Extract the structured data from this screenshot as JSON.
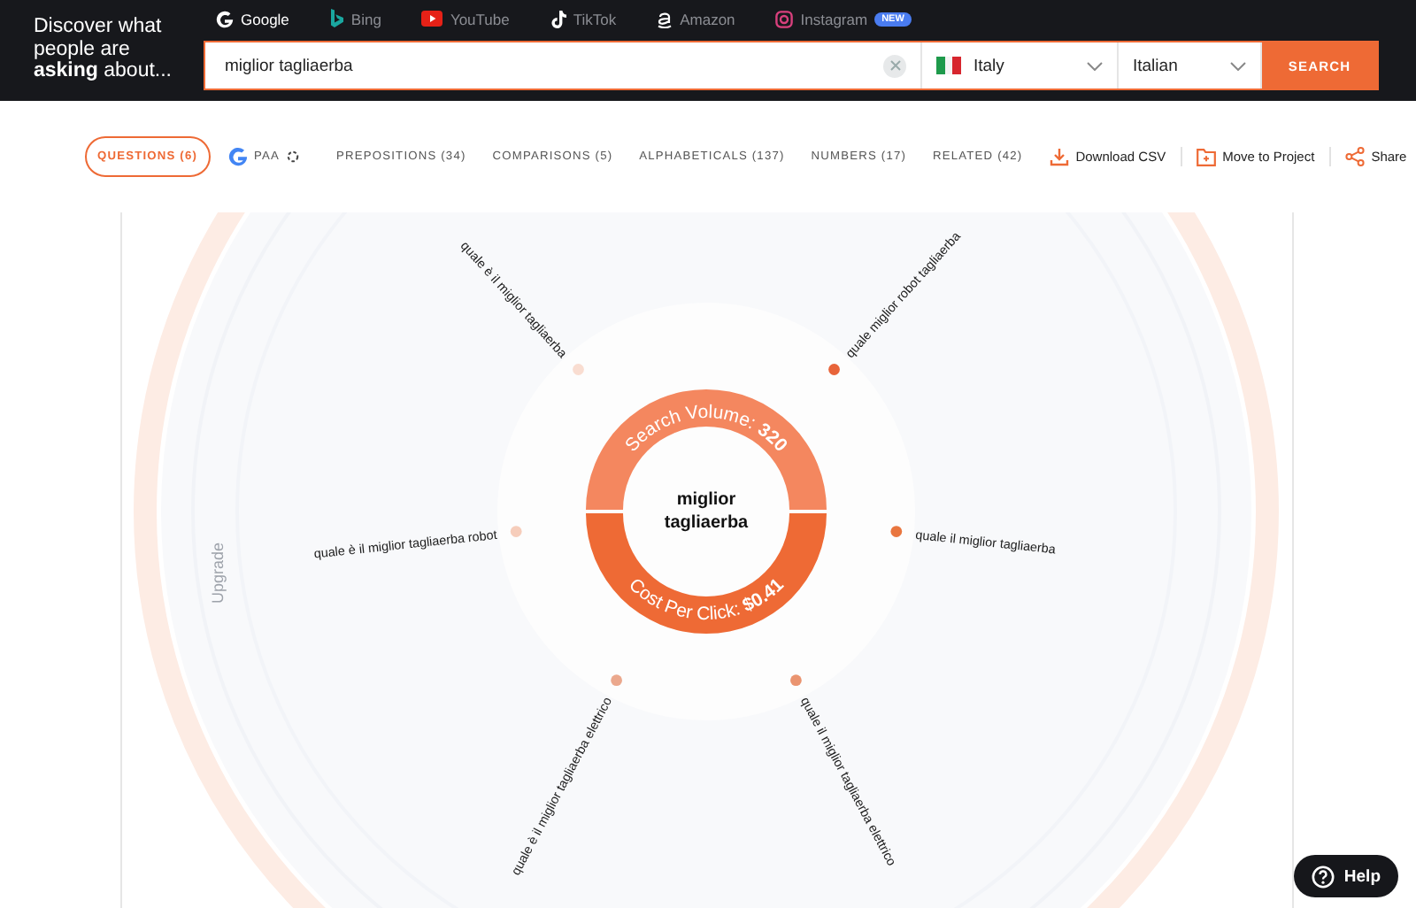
{
  "header": {
    "tagline": "Discover what people are **asking** about...",
    "engines": [
      {
        "label": "Google",
        "kind": "google",
        "selected": true
      },
      {
        "label": "Bing",
        "kind": "bing",
        "selected": false
      },
      {
        "label": "YouTube",
        "kind": "youtube",
        "selected": false
      },
      {
        "label": "TikTok",
        "kind": "tiktok",
        "selected": false
      },
      {
        "label": "Amazon",
        "kind": "amazon",
        "selected": false
      },
      {
        "label": "Instagram",
        "kind": "instagram",
        "selected": false,
        "badge": "NEW"
      }
    ]
  },
  "search": {
    "value": "miglior tagliaerba"
  },
  "country": {
    "value": "Italy"
  },
  "language": {
    "value": "Italian"
  },
  "search_button": "SEARCH",
  "filters": [
    {
      "label": "QUESTIONS (6)",
      "kind": "pill",
      "selected": true
    },
    {
      "label": "PAA",
      "kind": "paa",
      "selected": false
    },
    {
      "label": "PREPOSITIONS (34)",
      "kind": "plain",
      "selected": false
    },
    {
      "label": "COMPARISONS (5)",
      "kind": "plain",
      "selected": false
    },
    {
      "label": "ALPHABETICALS (137)",
      "kind": "plain",
      "selected": false
    },
    {
      "label": "NUMBERS (17)",
      "kind": "plain",
      "selected": false
    },
    {
      "label": "RELATED (42)",
      "kind": "plain",
      "selected": false
    }
  ],
  "actions": [
    {
      "label": "Download CSV",
      "kind": "download"
    },
    {
      "label": "Move to Project",
      "kind": "folder"
    },
    {
      "label": "Share",
      "kind": "share"
    }
  ],
  "visualization": {
    "keyword": "miglior tagliaerba",
    "search_volume": {
      "label": "Search Volume:",
      "value": "320"
    },
    "cost_per_click": {
      "label": "Cost Per Click:",
      "value": "$0.41"
    },
    "upgrade": "Upgrade",
    "questions": [
      {
        "text": "quale è il miglior tagliaerba",
        "color": "#f9ddd1"
      },
      {
        "text": "quale miglior robot tagliaerba",
        "color": "#e8643a"
      },
      {
        "text": "quale è il miglior tagliaerba robot",
        "color": "#f6cdbb"
      },
      {
        "text": "quale il miglior tagliaerba",
        "color": "#e9763f"
      },
      {
        "text": "quale è il miglior tagliaerba elettrico",
        "color": "#eba88d"
      },
      {
        "text": "quale il miglior tagliaerba elettrico",
        "color": "#ea9470"
      }
    ]
  },
  "help": "Help"
}
